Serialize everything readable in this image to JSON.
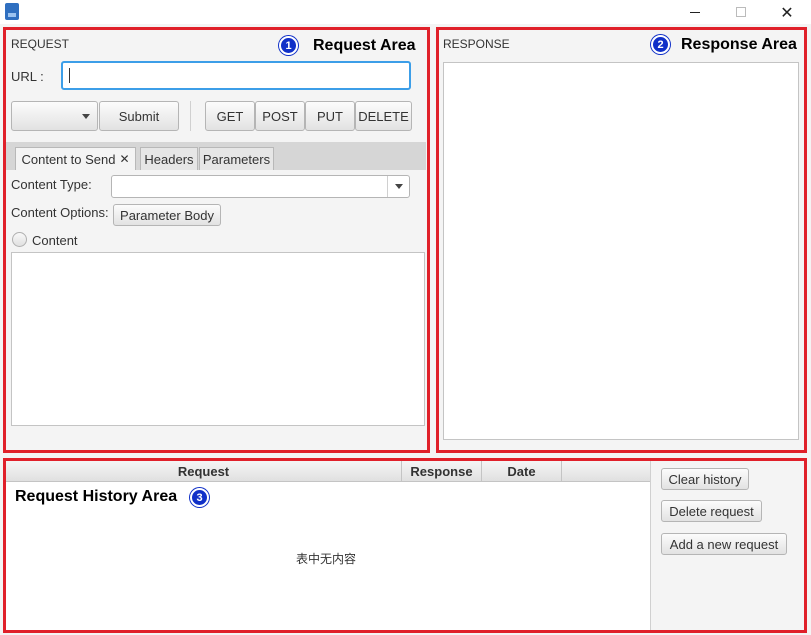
{
  "window": {
    "icons": {
      "app": "app-icon",
      "minimize": "minimize-icon",
      "maximize": "maximize-icon",
      "close": "close-icon"
    },
    "close_glyph": "✕"
  },
  "request": {
    "section_label": "REQUEST",
    "annotation_number": "1",
    "annotation_title": "Request Area",
    "url_label": "URL :",
    "url_value": "",
    "method_select_value": "",
    "submit_label": "Submit",
    "methods": [
      "GET",
      "POST",
      "PUT",
      "DELETE"
    ],
    "tabs": [
      {
        "label": "Content to Send",
        "close": "✕"
      },
      {
        "label": "Headers"
      },
      {
        "label": "Parameters"
      }
    ],
    "content_type_label": "Content Type:",
    "content_type_value": "",
    "content_options_label": "Content Options:",
    "parameter_body_label": "Parameter Body",
    "content_radio_label": "Content",
    "content_text": ""
  },
  "response": {
    "section_label": "RESPONSE",
    "annotation_number": "2",
    "annotation_title": "Response Area",
    "body_text": ""
  },
  "history": {
    "annotation_number": "3",
    "annotation_title": "Request History Area",
    "columns": [
      "Request",
      "Response",
      "Date"
    ],
    "empty_message": "表中无内容",
    "buttons": {
      "clear": "Clear history",
      "delete": "Delete request",
      "add": "Add a new request"
    }
  },
  "colors": {
    "highlight_border": "#e0202a",
    "badge": "#1030c8",
    "focus": "#3c9ee8"
  }
}
